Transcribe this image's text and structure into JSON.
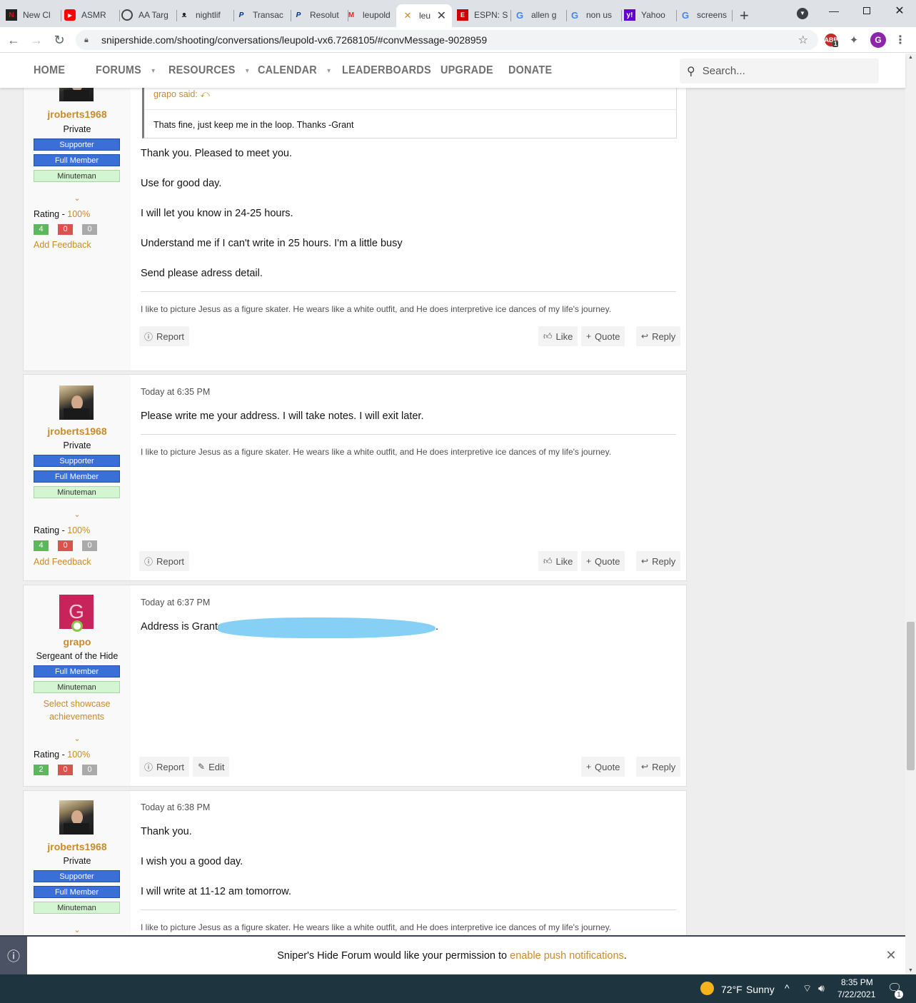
{
  "browser": {
    "tabs": [
      {
        "label": "New Cl",
        "favicon": "netflix-icon",
        "color": "#e50914"
      },
      {
        "label": "ASMR",
        "favicon": "youtube-icon",
        "color": "#ff0000"
      },
      {
        "label": "AA Targ",
        "favicon": "globe-icon",
        "color": "#555555"
      },
      {
        "label": "nightlif",
        "favicon": "bat-icon",
        "color": "#333333"
      },
      {
        "label": "Transac",
        "favicon": "paypal-icon",
        "color": "#003087"
      },
      {
        "label": "Resolut",
        "favicon": "paypal-icon",
        "color": "#003087"
      },
      {
        "label": "leupold",
        "favicon": "gmail-icon",
        "color": "#d93025"
      },
      {
        "label": "leu",
        "favicon": "snipershide-icon",
        "color": "#c88a2a",
        "active": true
      },
      {
        "label": "ESPN: S",
        "favicon": "espn-icon",
        "color": "#cc0000"
      },
      {
        "label": "allen g",
        "favicon": "google-icon",
        "color": "#4285f4"
      },
      {
        "label": "non us",
        "favicon": "google-icon",
        "color": "#4285f4"
      },
      {
        "label": "Yahoo",
        "favicon": "yahoo-icon",
        "color": "#6001d2"
      },
      {
        "label": "screens",
        "favicon": "google-icon",
        "color": "#4285f4"
      }
    ],
    "url": "snipershide.com/shooting/conversations/leupold-vx6.7268105/#convMessage-9028959",
    "profile_initial": "G",
    "ext_badge": "1"
  },
  "site_nav": {
    "items": [
      {
        "label": "HOME",
        "dropdown": false
      },
      {
        "label": "FORUMS",
        "dropdown": true
      },
      {
        "label": "RESOURCES",
        "dropdown": true
      },
      {
        "label": "CALENDAR",
        "dropdown": true
      },
      {
        "label": "LEADERBOARDS",
        "dropdown": false
      },
      {
        "label": "UPGRADE",
        "dropdown": false
      },
      {
        "label": "DONATE",
        "dropdown": false
      }
    ],
    "search_placeholder": "Search..."
  },
  "messages": [
    {
      "user": "jroberts1968",
      "title": "Private",
      "badges": [
        "Supporter",
        "Full Member",
        "Minuteman"
      ],
      "rating_label": "Rating - ",
      "rating_pct": "100%",
      "rating_counts": [
        "4",
        "0",
        "0"
      ],
      "add_feedback": "Add Feedback",
      "quote_author": "grapo said:",
      "quote_text": "Thats fine, just keep me in the loop. Thanks -Grant",
      "lines": [
        "Thank you. Pleased to meet you.",
        "Use for good day.",
        "I will let you know in 24-25 hours.",
        "Understand me if I can't write in 25 hours. I'm a little busy",
        "Send please adress detail."
      ],
      "signature": "I like to picture Jesus as a figure skater. He wears like a white outfit, and He does interpretive ice dances of my life's journey.",
      "actions": {
        "report": "Report",
        "like": "Like",
        "quote": "Quote",
        "reply": "Reply"
      }
    },
    {
      "user": "jroberts1968",
      "title": "Private",
      "badges": [
        "Supporter",
        "Full Member",
        "Minuteman"
      ],
      "rating_label": "Rating - ",
      "rating_pct": "100%",
      "rating_counts": [
        "4",
        "0",
        "0"
      ],
      "add_feedback": "Add Feedback",
      "date": "Today at 6:35 PM",
      "lines": [
        "Please write me your address. I will take notes. I will exit later."
      ],
      "signature": "I like to picture Jesus as a figure skater. He wears like a white outfit, and He does interpretive ice dances of my life's journey.",
      "actions": {
        "report": "Report",
        "like": "Like",
        "quote": "Quote",
        "reply": "Reply"
      }
    },
    {
      "user": "grapo",
      "title": "Sergeant of the Hide",
      "avatar_letter": "G",
      "badges": [
        "Full Member",
        "Minuteman"
      ],
      "showcase": "Select showcase achievements",
      "rating_label": "Rating - ",
      "rating_pct": "100%",
      "rating_counts": [
        "2",
        "0",
        "0"
      ],
      "date": "Today at 6:37 PM",
      "lines": [
        "Address is Grant"
      ],
      "line_end": ".",
      "actions": {
        "report": "Report",
        "edit": "Edit",
        "quote": "Quote",
        "reply": "Reply"
      }
    },
    {
      "user": "jroberts1968",
      "title": "Private",
      "badges": [
        "Supporter",
        "Full Member",
        "Minuteman"
      ],
      "date": "Today at 6:38 PM",
      "lines": [
        "Thank you.",
        "I wish you a good day.",
        "I will write at 11-12 am tomorrow."
      ],
      "signature": "I like to picture Jesus as a figure skater. He wears like a white outfit, and He does interpretive ice dances of my life's journey."
    }
  ],
  "notification": {
    "prefix": "Sniper's Hide Forum would like your permission to ",
    "link": "enable push notifications",
    "suffix": "."
  },
  "taskbar": {
    "temp": "72°F",
    "weather": "Sunny",
    "time": "8:35 PM",
    "date": "7/22/2021",
    "notif_count": "1"
  }
}
